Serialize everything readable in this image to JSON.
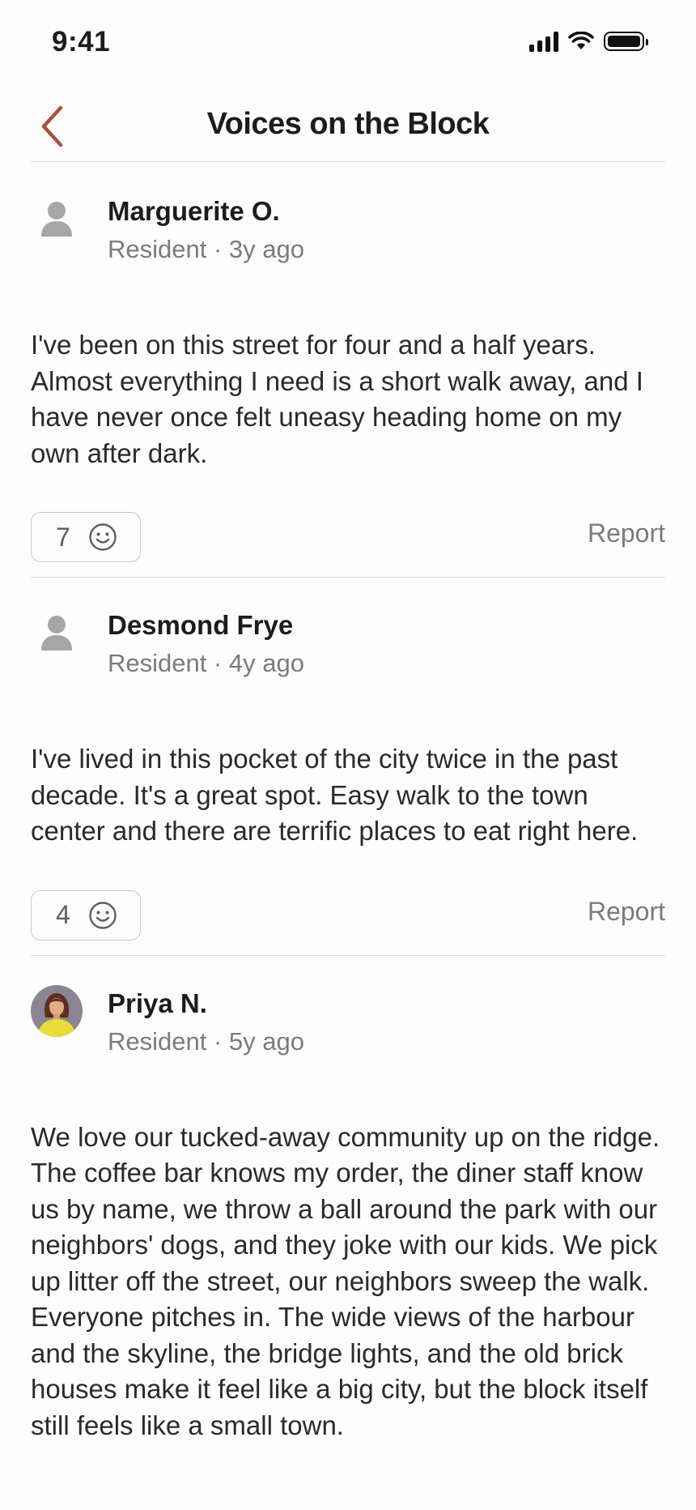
{
  "status_bar": {
    "time": "9:41"
  },
  "nav": {
    "title": "Voices on the Block",
    "back_icon": "chevron-left-icon",
    "accent": "#a4543a"
  },
  "reviews": [
    {
      "author": "Marguerite O.",
      "meta": "Resident · 3y ago",
      "avatar": "person-placeholder-icon",
      "body": "I've been on this street for four and a half years. Almost everything I need is a short walk away, and I have never once felt uneasy heading home on my own after dark.",
      "reactions": "7",
      "report_label": "Report"
    },
    {
      "author": "Desmond Frye",
      "meta": "Resident · 4y ago",
      "avatar": "person-placeholder-icon",
      "body": "I've lived in this pocket of the city twice in the past decade. It's a great spot. Easy walk to the town center and there are terrific places to eat right here.",
      "reactions": "4",
      "report_label": "Report"
    },
    {
      "author": "Priya N.",
      "meta": "Resident · 5y ago",
      "avatar": "profile-photo",
      "body": "We love our tucked-away community up on the ridge. The coffee bar knows my order, the diner staff know us by name, we throw a ball around the park with our neighbors' dogs, and they joke with our kids. We pick up litter off the street, our neighbors sweep the walk. Everyone pitches in. The wide views of the harbour and the skyline, the bridge lights, and the old brick houses make it feel like a big city, but the block itself still feels like a small town."
    }
  ]
}
